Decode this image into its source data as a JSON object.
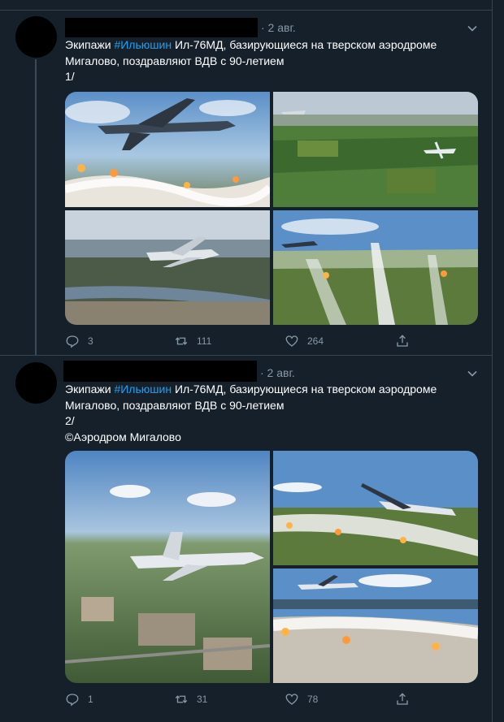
{
  "tweets": [
    {
      "date": "· 2 авг.",
      "text_prefix": "Экипажи ",
      "hashtag": "#Ильюшин",
      "text_line1_rest": " Ил-76МД, базирующиеся на тверском аэродроме",
      "text_line2": "Мигалово, поздравляют ВДВ с 90-летием",
      "text_line3": "1/",
      "photos": [
        "il76-fighter-flares-photo",
        "il76-over-fields-photo",
        "il76-over-city-photo",
        "il76-flares-trails-photo"
      ],
      "replies": "3",
      "retweets": "111",
      "likes": "264"
    },
    {
      "date": "· 2 авг.",
      "text_prefix": "Экипажи ",
      "hashtag": "#Ильюшин",
      "text_line1_rest": " Ил-76МД, базирующиеся на тверском аэродроме",
      "text_line2": "Мигалово, поздравляют ВДВ с 90-летием",
      "text_line3": "2/",
      "text_line4": "©Аэродром Мигалово",
      "photos": [
        "il76-over-town-photo",
        "il76-climb-flares-photo",
        "il76-flares-burst-photo"
      ],
      "replies": "1",
      "retweets": "31",
      "likes": "78"
    }
  ],
  "colors": {
    "background": "#15202b",
    "text": "#ffffff",
    "secondary": "#8899a6",
    "hashtag": "#1da1f2",
    "border": "#38444d"
  }
}
